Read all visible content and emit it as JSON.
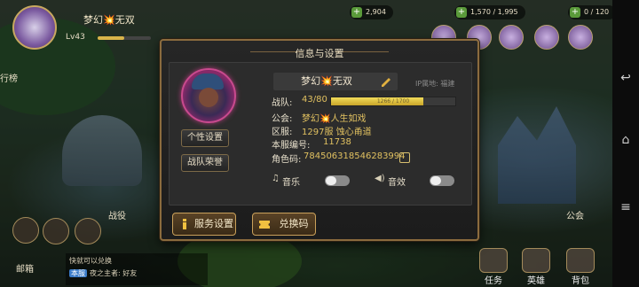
{
  "hud": {
    "player_name": "梦幻💥无双",
    "level": "Lv43",
    "resources": [
      "2,904",
      "1,570 / 1,995",
      "0 / 120"
    ]
  },
  "scene": {
    "left_tab": "行榜",
    "battle_label": "战役",
    "guild_label": "公会",
    "mailbox_label": "邮箱",
    "bottom_center": "..."
  },
  "chat": {
    "line1": "快就可以兑换",
    "line2_tag": "本服",
    "line2_text": "夜之主者: 好友"
  },
  "bottom_nav": [
    "任务",
    "英雄",
    "背包"
  ],
  "dialog": {
    "title": "信息与设置",
    "name": "梦幻💥无双",
    "ip_location": "IP属地: 福建",
    "team_label": "战队:",
    "team_value": "43/80",
    "exp_text": "1266 / 1700",
    "exp_fraction": 0.74,
    "guild_label": "公会:",
    "guild_value": "梦幻💥人生如戏",
    "server_label": "区服:",
    "server_value": "1297服 蚀心甬道",
    "local_id_label": "本服编号:",
    "local_id_value": "11738",
    "role_code_label": "角色码:",
    "role_code_value": "784506318546283994",
    "music_label": "音乐",
    "sound_label": "音效",
    "personal_button": "个性设置",
    "honor_button": "战队荣誉",
    "service_button": "服务设置",
    "redeem_button": "兑换码"
  },
  "colors": {
    "accent_gold": "#e0c060",
    "panel_border": "#8b6b3e",
    "avatar_ring": "#c94a8e"
  }
}
